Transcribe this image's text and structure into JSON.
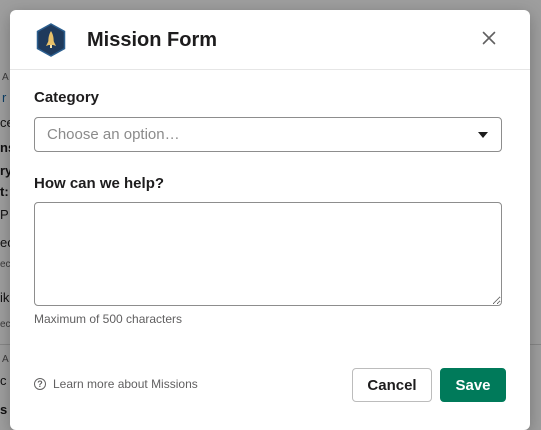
{
  "background": {
    "fragments": [
      "A",
      "r",
      "ce",
      "ns",
      "ry",
      "t:",
      "P",
      "ec",
      "ec",
      "ik",
      "ec",
      "A",
      "c",
      "s"
    ]
  },
  "modal": {
    "title": "Mission Form",
    "app_icon": "rocket-hexagon-icon",
    "close_icon": "close-icon",
    "category": {
      "label": "Category",
      "placeholder": "Choose an option…"
    },
    "help": {
      "label": "How can we help?",
      "value": "",
      "hint": "Maximum of 500 characters"
    },
    "footer": {
      "link_icon": "question-circle-icon",
      "link_text": "Learn more about Missions",
      "cancel_label": "Cancel",
      "save_label": "Save"
    }
  },
  "colors": {
    "primary": "#007a5a",
    "icon_bg": "#1f3a5c",
    "icon_accent": "#e8c16a"
  }
}
